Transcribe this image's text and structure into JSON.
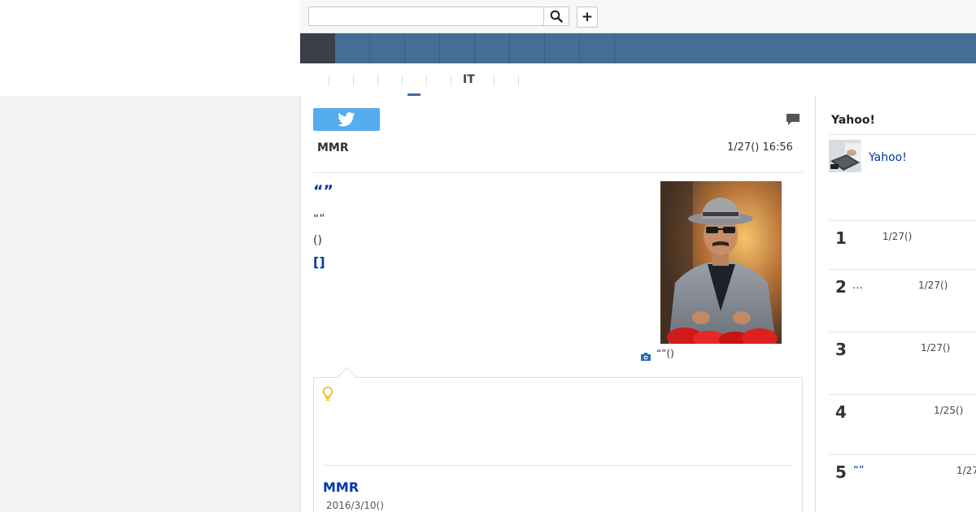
{
  "search": {
    "placeholder": "",
    "value": ""
  },
  "toolbar": {
    "plus_label": "+",
    "search_icon": "search-icon"
  },
  "nav": {
    "items": [
      "",
      "",
      "",
      "",
      "",
      "",
      "",
      ""
    ]
  },
  "subnav": {
    "active_label": "IT"
  },
  "article": {
    "tweet_icon": "twitter-icon",
    "source": "MMR",
    "date": "1/27() 16:56",
    "headline": "“”",
    "lead": "“”",
    "lead2": "()",
    "more_link": "[]",
    "photo_caption": "“”()"
  },
  "related": {
    "source": "MMR",
    "date": "2016/3/10()"
  },
  "sidebar": {
    "title": "Yahoo!",
    "feature_link": "Yahoo!",
    "ranking": [
      {
        "rank": "1",
        "title": "",
        "date": "1/27()"
      },
      {
        "rank": "2",
        "title": "…",
        "date": "1/27()"
      },
      {
        "rank": "3",
        "title": "",
        "date": "1/27()"
      },
      {
        "rank": "4",
        "title": "",
        "date": "1/25()"
      },
      {
        "rank": "5",
        "title": "“”",
        "date": "1/27"
      }
    ]
  },
  "colors": {
    "nav": "#456e96",
    "nav_home": "#3a3f4a",
    "link": "#0038a8",
    "twitter": "#55acee",
    "bulb": "#f0b400"
  }
}
